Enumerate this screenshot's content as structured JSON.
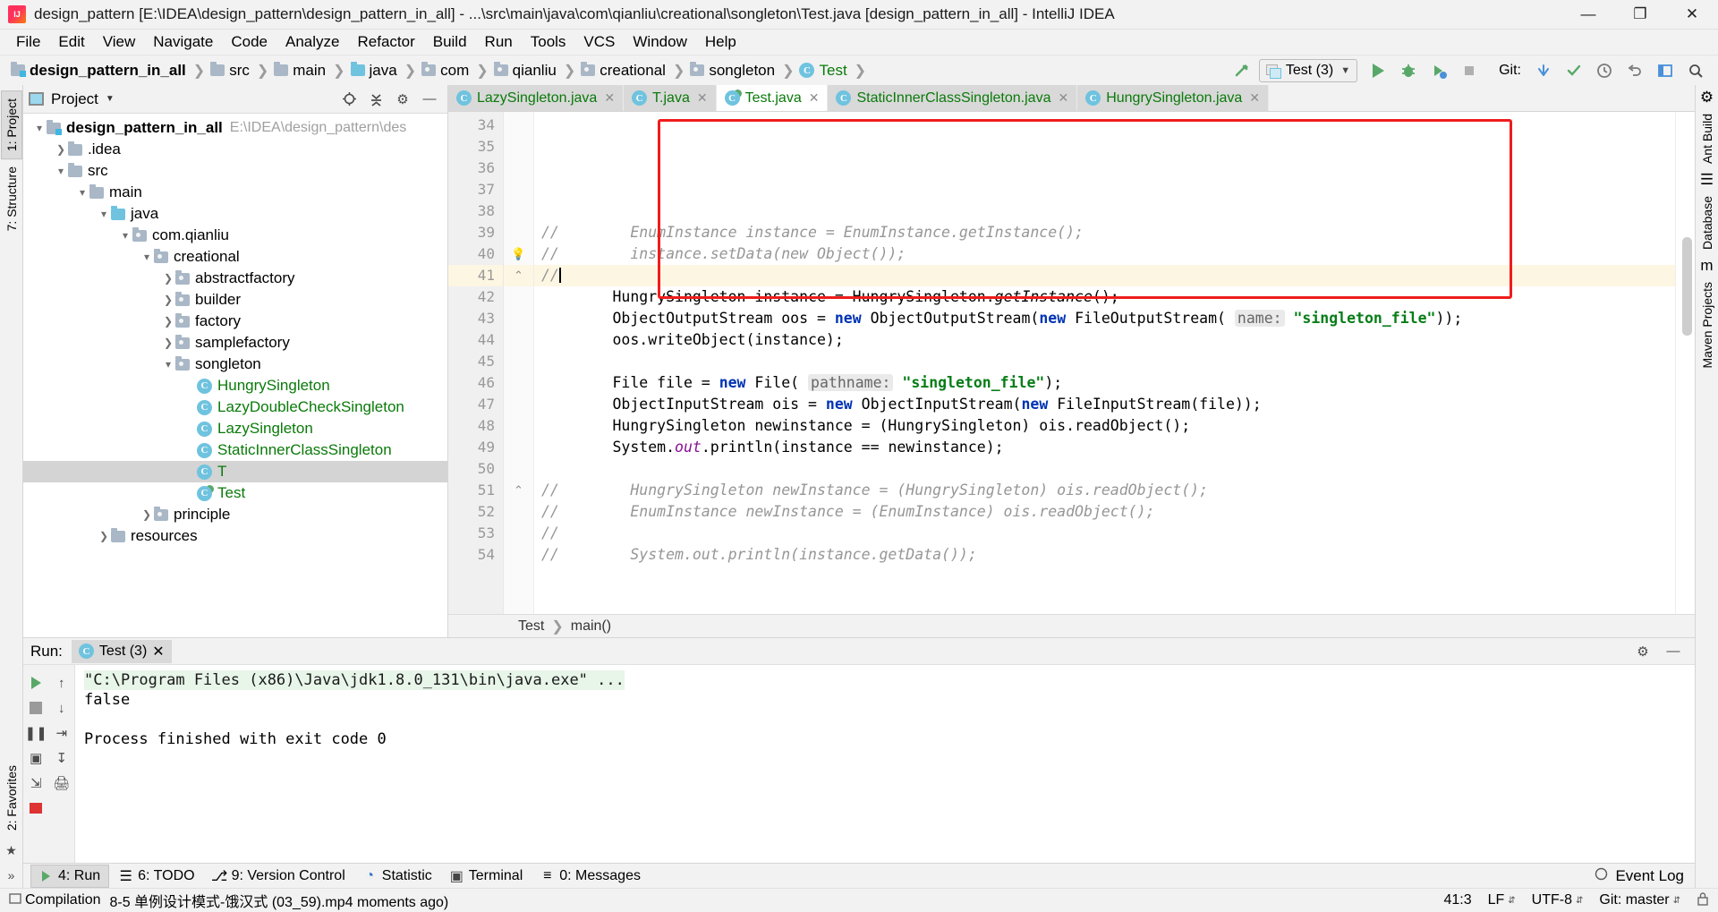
{
  "window": {
    "title": "design_pattern [E:\\IDEA\\design_pattern\\design_pattern_in_all] - ...\\src\\main\\java\\com\\qianliu\\creational\\songleton\\Test.java [design_pattern_in_all] - IntelliJ IDEA",
    "minimize": "—",
    "maximize": "❐",
    "close": "✕"
  },
  "menu": [
    "File",
    "Edit",
    "View",
    "Navigate",
    "Code",
    "Analyze",
    "Refactor",
    "Build",
    "Run",
    "Tools",
    "VCS",
    "Window",
    "Help"
  ],
  "breadcrumb": [
    {
      "label": "design_pattern_in_all",
      "icon": "project-folder-icon",
      "bold": true
    },
    {
      "label": "src",
      "icon": "folder-icon"
    },
    {
      "label": "main",
      "icon": "folder-icon"
    },
    {
      "label": "java",
      "icon": "source-folder-icon"
    },
    {
      "label": "com",
      "icon": "package-icon"
    },
    {
      "label": "qianliu",
      "icon": "package-icon"
    },
    {
      "label": "creational",
      "icon": "package-icon"
    },
    {
      "label": "songleton",
      "icon": "package-icon"
    },
    {
      "label": "Test",
      "icon": "class-icon"
    }
  ],
  "toolbar": {
    "build_icon": "hammer-icon",
    "run_config": "Test (3)",
    "run_icon": "run-icon",
    "debug_icon": "debug-icon",
    "coverage_icon": "run-with-coverage-icon",
    "stop_icon": "stop-icon",
    "git_label": "Git:",
    "git_update_icon": "update-project-icon",
    "git_commit_icon": "commit-icon",
    "git_history_icon": "history-icon",
    "git_revert_icon": "revert-icon",
    "layout_icon": "layout-icon",
    "search_icon": "search-everywhere-icon"
  },
  "left_strip": {
    "project_tab": "1: Project",
    "structure_tab": "7: Structure",
    "favorites_tab": "2: Favorites"
  },
  "right_strip": {
    "ant_build": "Ant Build",
    "database": "Database",
    "maven": "Maven Projects"
  },
  "project_panel": {
    "title": "Project",
    "locate_icon": "locate-icon",
    "collapse_icon": "collapse-all-icon",
    "settings_icon": "gear-icon",
    "hide_icon": "hide-icon",
    "tree": [
      {
        "label": "design_pattern_in_all",
        "path": "E:\\IDEA\\design_pattern\\des",
        "indent": 0,
        "arrow": "down",
        "icon": "project-folder-icon",
        "bold": true
      },
      {
        "label": ".idea",
        "indent": 1,
        "arrow": "right",
        "icon": "folder-icon"
      },
      {
        "label": "src",
        "indent": 1,
        "arrow": "down",
        "icon": "folder-icon"
      },
      {
        "label": "main",
        "indent": 2,
        "arrow": "down",
        "icon": "folder-icon"
      },
      {
        "label": "java",
        "indent": 3,
        "arrow": "down",
        "icon": "source-folder-icon"
      },
      {
        "label": "com.qianliu",
        "indent": 4,
        "arrow": "down",
        "icon": "package-icon"
      },
      {
        "label": "creational",
        "indent": 5,
        "arrow": "down",
        "icon": "package-icon"
      },
      {
        "label": "abstractfactory",
        "indent": 6,
        "arrow": "right",
        "icon": "package-icon"
      },
      {
        "label": "builder",
        "indent": 6,
        "arrow": "right",
        "icon": "package-icon"
      },
      {
        "label": "factory",
        "indent": 6,
        "arrow": "right",
        "icon": "package-icon"
      },
      {
        "label": "samplefactory",
        "indent": 6,
        "arrow": "right",
        "icon": "package-icon"
      },
      {
        "label": "songleton",
        "indent": 6,
        "arrow": "down",
        "icon": "package-icon"
      },
      {
        "label": "HungrySingleton",
        "indent": 7,
        "arrow": "none",
        "icon": "class-icon",
        "green": true
      },
      {
        "label": "LazyDoubleCheckSingleton",
        "indent": 7,
        "arrow": "none",
        "icon": "class-icon",
        "green": true
      },
      {
        "label": "LazySingleton",
        "indent": 7,
        "arrow": "none",
        "icon": "class-icon",
        "green": true
      },
      {
        "label": "StaticInnerClassSingleton",
        "indent": 7,
        "arrow": "none",
        "icon": "class-icon",
        "green": true
      },
      {
        "label": "T",
        "indent": 7,
        "arrow": "none",
        "icon": "class-icon",
        "green": true,
        "selected": true
      },
      {
        "label": "Test",
        "indent": 7,
        "arrow": "none",
        "icon": "runnable-class-icon",
        "green": true
      },
      {
        "label": "principle",
        "indent": 5,
        "arrow": "right",
        "icon": "package-icon"
      },
      {
        "label": "resources",
        "indent": 3,
        "arrow": "right",
        "icon": "folder-icon"
      }
    ]
  },
  "editor": {
    "tabs": [
      {
        "label": "LazySingleton.java",
        "icon": "class-icon",
        "active": false
      },
      {
        "label": "T.java",
        "icon": "class-icon",
        "active": false
      },
      {
        "label": "Test.java",
        "icon": "runnable-class-icon",
        "active": true
      },
      {
        "label": "StaticInnerClassSingleton.java",
        "icon": "class-icon",
        "active": false
      },
      {
        "label": "HungrySingleton.java",
        "icon": "class-icon",
        "active": false
      }
    ],
    "first_line": 34,
    "lines": [
      {
        "num": 34,
        "fold": "",
        "segments": []
      },
      {
        "num": 35,
        "fold": "",
        "segments": []
      },
      {
        "num": 36,
        "fold": "",
        "segments": []
      },
      {
        "num": 37,
        "fold": "",
        "segments": []
      },
      {
        "num": 38,
        "fold": "",
        "segments": []
      },
      {
        "num": 39,
        "fold": "",
        "segments": [
          {
            "t": "//        EnumInstance instance = EnumInstance.getInstance();",
            "c": "cmt"
          }
        ]
      },
      {
        "num": 40,
        "fold": "bulb",
        "segments": [
          {
            "t": "//        instance.setData(new Object());",
            "c": "cmt"
          }
        ]
      },
      {
        "num": 41,
        "fold": "fold-end",
        "highlight": true,
        "caret": true,
        "segments": [
          {
            "t": "//",
            "c": "cmt"
          }
        ]
      },
      {
        "num": 42,
        "fold": "",
        "segments": [
          {
            "t": "        HungrySingleton instance = HungrySingleton.",
            "c": ""
          },
          {
            "t": "getInstance",
            "c": "mth"
          },
          {
            "t": "();",
            "c": ""
          }
        ]
      },
      {
        "num": 43,
        "fold": "",
        "segments": [
          {
            "t": "        ObjectOutputStream oos = ",
            "c": ""
          },
          {
            "t": "new",
            "c": "kw"
          },
          {
            "t": " ObjectOutputStream(",
            "c": ""
          },
          {
            "t": "new",
            "c": "kw"
          },
          {
            "t": " FileOutputStream( ",
            "c": ""
          },
          {
            "t": "name:",
            "c": "hint"
          },
          {
            "t": " ",
            "c": ""
          },
          {
            "t": "\"singleton_file\"",
            "c": "str"
          },
          {
            "t": "));",
            "c": ""
          }
        ]
      },
      {
        "num": 44,
        "fold": "",
        "segments": [
          {
            "t": "        oos.writeObject(instance);",
            "c": ""
          }
        ]
      },
      {
        "num": 45,
        "fold": "",
        "segments": []
      },
      {
        "num": 46,
        "fold": "",
        "segments": [
          {
            "t": "        File file = ",
            "c": ""
          },
          {
            "t": "new",
            "c": "kw"
          },
          {
            "t": " File( ",
            "c": ""
          },
          {
            "t": "pathname:",
            "c": "hint"
          },
          {
            "t": " ",
            "c": ""
          },
          {
            "t": "\"singleton_file\"",
            "c": "str"
          },
          {
            "t": ");",
            "c": ""
          }
        ]
      },
      {
        "num": 47,
        "fold": "",
        "segments": [
          {
            "t": "        ObjectInputStream ois = ",
            "c": ""
          },
          {
            "t": "new",
            "c": "kw"
          },
          {
            "t": " ObjectInputStream(",
            "c": ""
          },
          {
            "t": "new",
            "c": "kw"
          },
          {
            "t": " FileInputStream(file));",
            "c": ""
          }
        ]
      },
      {
        "num": 48,
        "fold": "",
        "segments": [
          {
            "t": "        HungrySingleton newinstance = (HungrySingleton) ois.readObject();",
            "c": ""
          }
        ]
      },
      {
        "num": 49,
        "fold": "",
        "segments": [
          {
            "t": "        System.",
            "c": ""
          },
          {
            "t": "out",
            "c": "fld"
          },
          {
            "t": ".println(instance == newinstance);",
            "c": ""
          }
        ]
      },
      {
        "num": 50,
        "fold": "",
        "segments": []
      },
      {
        "num": 51,
        "fold": "fold-end",
        "segments": [
          {
            "t": "//        HungrySingleton newInstance = (HungrySingleton) ois.readObject();",
            "c": "cmt"
          }
        ]
      },
      {
        "num": 52,
        "fold": "",
        "segments": [
          {
            "t": "//        EnumInstance newInstance = (EnumInstance) ois.readObject();",
            "c": "cmt"
          }
        ]
      },
      {
        "num": 53,
        "fold": "",
        "segments": [
          {
            "t": "//",
            "c": "cmt"
          }
        ]
      },
      {
        "num": 54,
        "fold": "",
        "segments": [
          {
            "t": "//        System.out.println(instance.getData());",
            "c": "cmt"
          }
        ]
      }
    ],
    "bottom_breadcrumb": [
      "Test",
      "main()"
    ],
    "redbox_color": "#f01c1c"
  },
  "run_panel": {
    "label": "Run:",
    "tab": "Test (3)",
    "tab_icon": "runnable-class-icon",
    "close_icon": "close-icon",
    "settings_icon": "gear-icon",
    "hide_icon": "hide-icon",
    "side_icons": [
      "rerun-icon",
      "up-icon",
      "stop-icon",
      "down-icon",
      "pause-icon",
      "soft-wrap-icon",
      "camera-icon",
      "scroll-to-end-icon",
      "export-icon",
      "print-icon",
      "clear-all-icon"
    ],
    "console": [
      {
        "text": "\"C:\\Program Files (x86)\\Java\\jdk1.8.0_131\\bin\\java.exe\" ...",
        "style": "cmdline"
      },
      {
        "text": "false",
        "style": ""
      },
      {
        "text": "",
        "style": ""
      },
      {
        "text": "Process finished with exit code 0",
        "style": ""
      }
    ]
  },
  "bottom_tools": [
    {
      "label": "4: Run",
      "num": "4",
      "icon": "run-icon",
      "selected": true
    },
    {
      "label": "6: TODO",
      "num": "6",
      "icon": "todo-icon"
    },
    {
      "label": "9: Version Control",
      "num": "9",
      "icon": "vcs-icon"
    },
    {
      "label": "Statistic",
      "icon": "statistic-icon"
    },
    {
      "label": "Terminal",
      "icon": "terminal-icon"
    },
    {
      "label": "0: Messages",
      "num": "0",
      "icon": "messages-icon"
    }
  ],
  "bottom_right": {
    "event_log": "Event Log",
    "event_log_icon": "event-log-icon"
  },
  "status_bar": {
    "compilation_label": "Compilation",
    "progress_text": "8-5 单例设计模式-饿汉式 (03_59).mp4 moments ago)",
    "caret_position": "41:3",
    "line_separator": "LF",
    "encoding": "UTF-8",
    "git_branch": "Git: master",
    "lock_icon": "lock-icon"
  }
}
